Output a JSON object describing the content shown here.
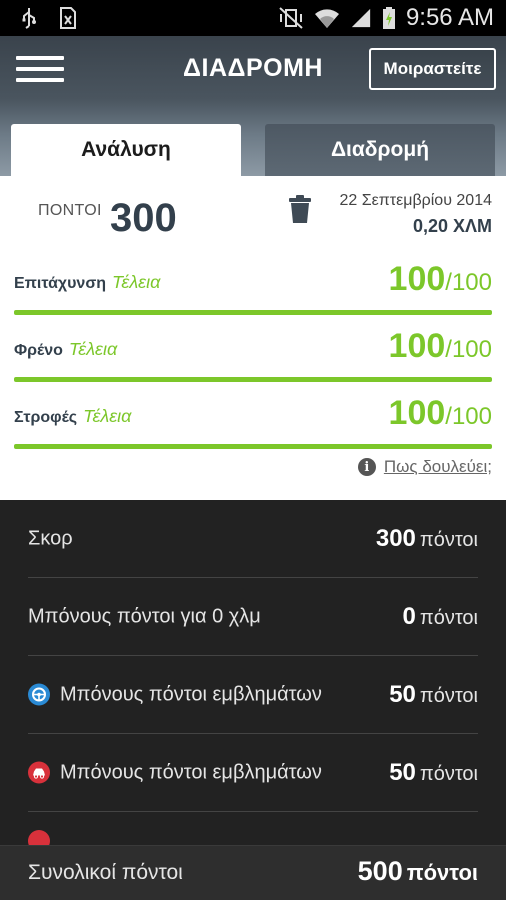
{
  "status_bar": {
    "time": "9:56 AM",
    "icons": [
      "usb-icon",
      "sd-card-icon",
      "vibrate-mute-icon",
      "wifi-icon",
      "signal-icon",
      "battery-charging-icon"
    ]
  },
  "header": {
    "title": "ΔΙΑΔΡΟΜΗ",
    "share_label": "Μοιραστείτε",
    "menu_icon": "hamburger-menu-icon"
  },
  "tabs": [
    {
      "label": "Ανάλυση",
      "active": true
    },
    {
      "label": "Διαδρομή",
      "active": false
    }
  ],
  "summary": {
    "points_label": "ΠΟΝΤΟΙ",
    "points_value": "300",
    "date": "22 Σεπτεμβρίου 2014",
    "distance": "0,20 ΧΛΜ"
  },
  "metrics": [
    {
      "label": "Επιτάχυνση",
      "quality": "Τέλεια",
      "value": "100",
      "max": "/100",
      "fraction": 1.0
    },
    {
      "label": "Φρένο",
      "quality": "Τέλεια",
      "value": "100",
      "max": "/100",
      "fraction": 1.0
    },
    {
      "label": "Στροφές",
      "quality": "Τέλεια",
      "value": "100",
      "max": "/100",
      "fraction": 1.0
    }
  ],
  "how_it_works": "Πως δουλεύει;",
  "list": [
    {
      "label": "Σκορ",
      "value": "300",
      "unit": "πόντοι",
      "badge": null
    },
    {
      "label": "Μπόνους πόντοι για 0 χλμ",
      "value": "0",
      "unit": "πόντοι",
      "badge": null
    },
    {
      "label": "Μπόνους πόντοι εμβλημάτων",
      "value": "50",
      "unit": "πόντοι",
      "badge": "steering-wheel-badge-icon",
      "badge_color": "#2a8ad4"
    },
    {
      "label": "Μπόνους πόντοι εμβλημάτων",
      "value": "50",
      "unit": "πόντοι",
      "badge": "car-badge-icon",
      "badge_color": "#d8313b"
    }
  ],
  "footer": {
    "label": "Συνολικοί πόντοι",
    "value": "500",
    "unit": "πόντοι"
  },
  "colors": {
    "accent_green": "#7cc72a",
    "dark_text": "#33404c",
    "list_bg": "#222222"
  }
}
